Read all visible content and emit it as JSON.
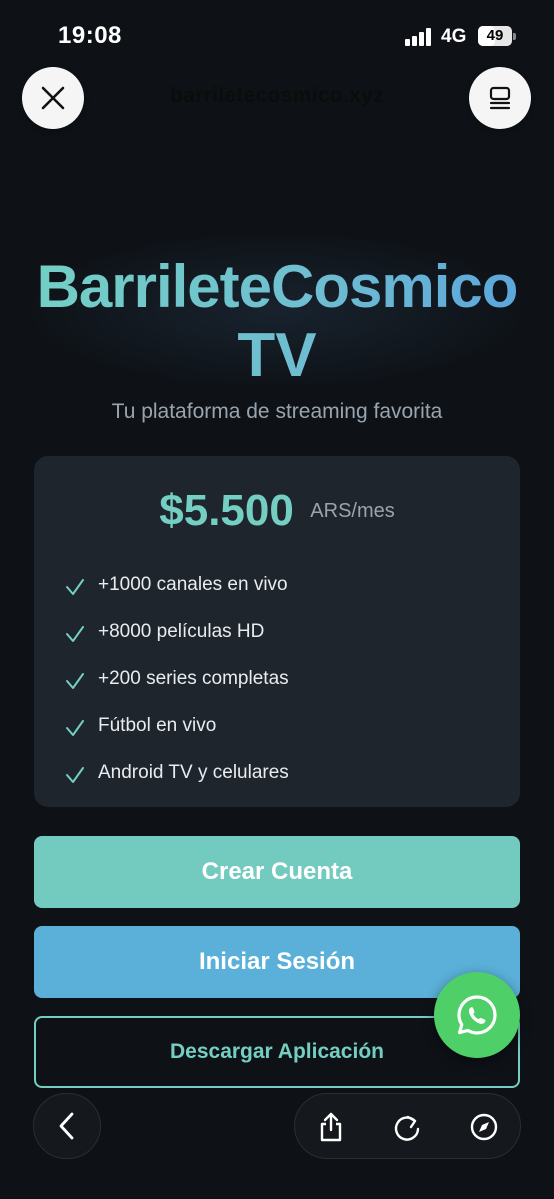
{
  "status_bar": {
    "time": "19:08",
    "network": "4G",
    "battery_level": "49",
    "battery_fraction": 0.49
  },
  "browser": {
    "url": "barriletecosmico.xyz",
    "close_icon": "close-icon",
    "menu_icon": "reader-menu-icon"
  },
  "hero": {
    "brand_line1": "BarrileteCosmico",
    "brand_line2": "TV",
    "tagline": "Tu plataforma de streaming favorita"
  },
  "plan": {
    "price": "$5.500",
    "unit": "ARS/mes",
    "features": [
      "+1000 canales en vivo",
      "+8000 películas HD",
      "+200 series completas",
      "Fútbol en vivo",
      "Android TV y celulares"
    ]
  },
  "actions": {
    "create_account": "Crear Cuenta",
    "login": "Iniciar Sesión",
    "download_app": "Descargar Aplicación"
  },
  "toolbar": {
    "icons": [
      "back-icon",
      "share-icon",
      "reload-icon",
      "compass-icon"
    ]
  },
  "colors": {
    "accent_teal": "#74cfc2",
    "accent_blue": "#5ab0d8",
    "whatsapp_green": "#4fcf67",
    "background": "#0e1217",
    "card": "#1f252d"
  }
}
